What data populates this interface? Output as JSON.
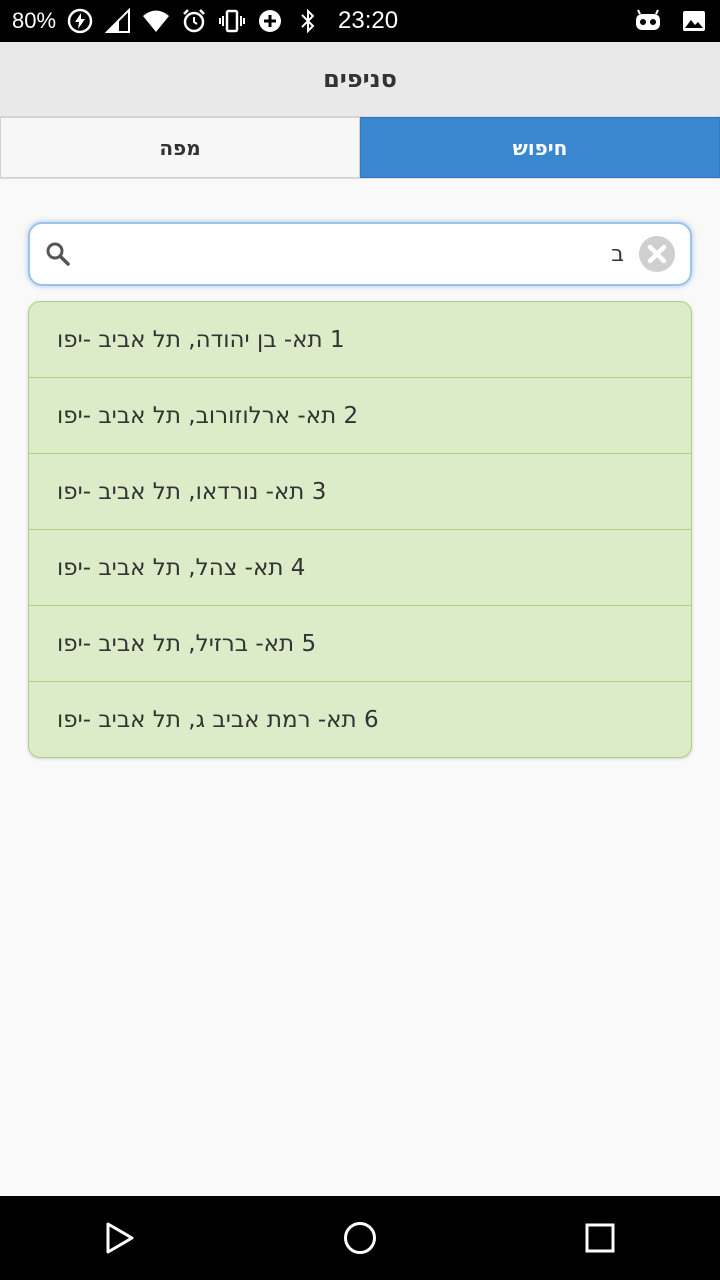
{
  "status_bar": {
    "battery": "80%",
    "time": "23:20"
  },
  "header": {
    "title": "סניפים"
  },
  "tabs": [
    {
      "label": "חיפוש",
      "active": true
    },
    {
      "label": "מפה",
      "active": false
    }
  ],
  "search": {
    "value": "ב"
  },
  "results": [
    {
      "label": "1 תא- בן יהודה, תל אביב -יפו"
    },
    {
      "label": "2 תא- ארלוזורוב, תל אביב -יפו"
    },
    {
      "label": "3 תא- נורדאו, תל אביב -יפו"
    },
    {
      "label": "4 תא- צהל, תל אביב -יפו"
    },
    {
      "label": "5 תא- ברזיל, תל אביב -יפו"
    },
    {
      "label": "6 תא- רמת אביב ג, תל אביב -יפו"
    }
  ],
  "colors": {
    "active_tab": "#3a87cf",
    "list_background": "#dcecc8",
    "list_border": "#a9d27c"
  }
}
